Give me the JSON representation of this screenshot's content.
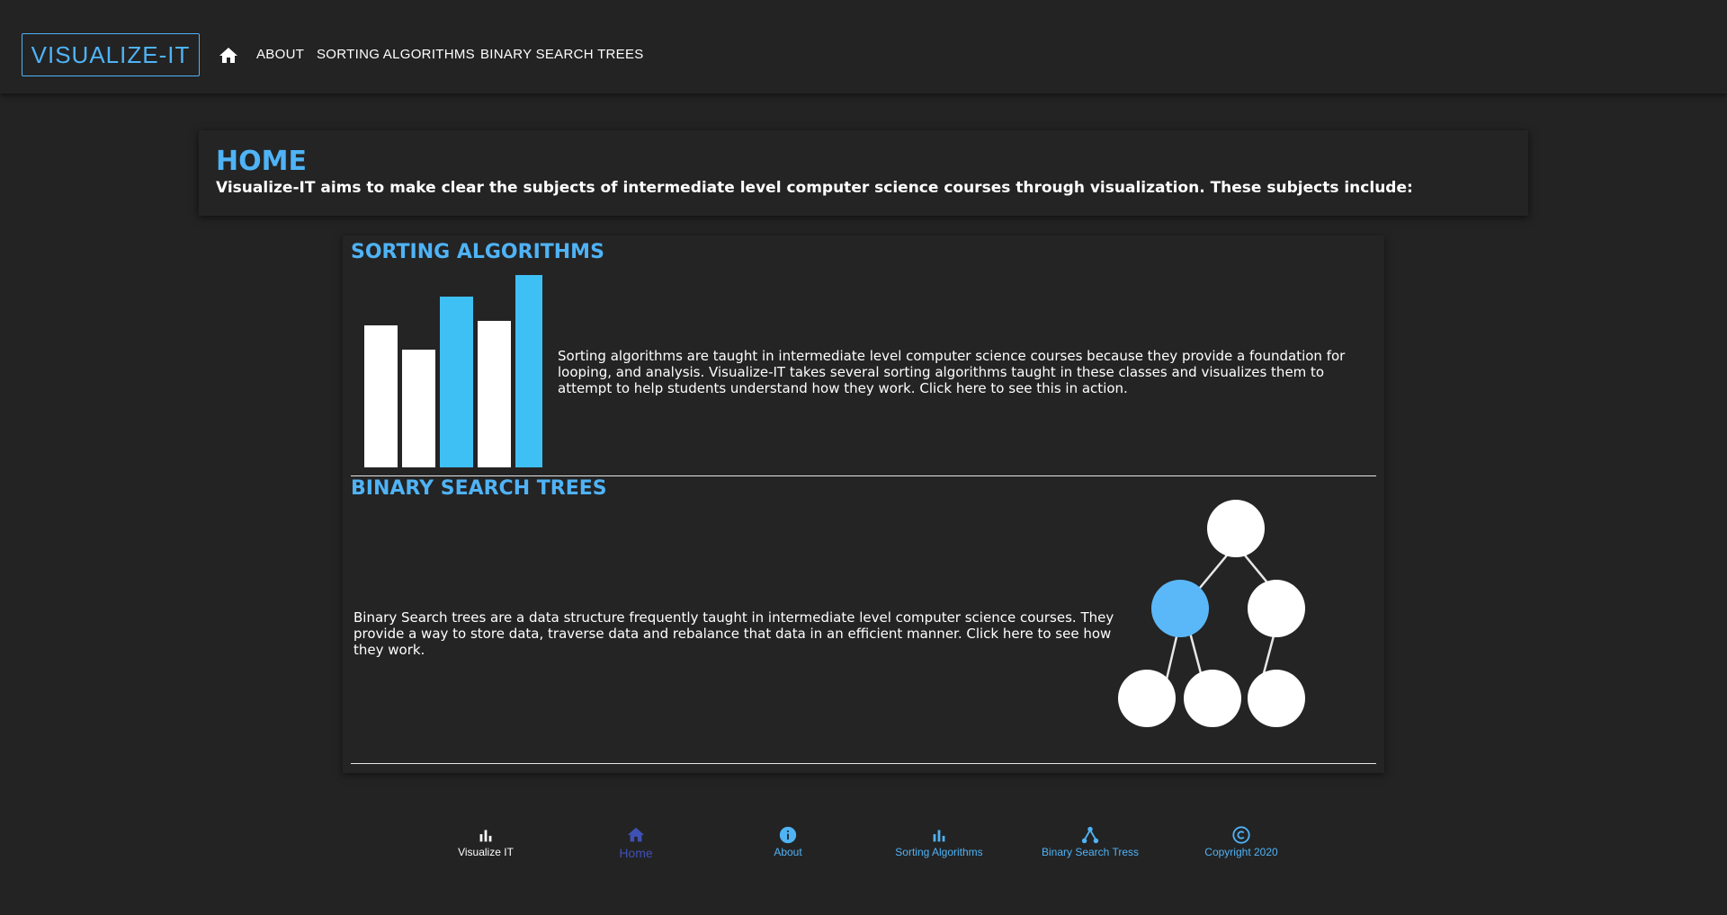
{
  "navbar": {
    "brand": "VISUALIZE-IT",
    "home_icon": "home-icon",
    "links": [
      "ABOUT",
      "SORTING ALGORITHMS",
      "BINARY SEARCH TREES"
    ]
  },
  "home": {
    "title": "HOME",
    "description": "Visualize-IT aims to make clear the subjects of intermediate level computer science courses through visualization. These subjects include:"
  },
  "sections": {
    "sorting": {
      "title": "SORTING ALGORITHMS",
      "text": "Sorting algorithms are taught in intermediate level computer science courses because they provide a foundation for looping, and analysis. Visualize-IT takes several sorting algorithms taught in these classes and visualizes them to attempt to help students understand how they work. Click here to see this in action.",
      "illustration": {
        "bar_heights": [
          0.74,
          0.61,
          0.89,
          0.76,
          1.0
        ],
        "bar_colors": [
          "#ffffff",
          "#ffffff",
          "#3ec0f5",
          "#ffffff",
          "#3ec0f5"
        ]
      }
    },
    "bst": {
      "title": "BINARY SEARCH TREES",
      "text": "Binary Search trees are a data structure frequently taught in intermediate level computer science courses. They provide a way to store data, traverse data and rebalance that data in an efficient manner. Click here to see how they work.",
      "illustration": {
        "highlight_color": "#5bb8f8",
        "node_color": "#ffffff"
      }
    }
  },
  "footer": {
    "items": [
      {
        "label": "Visualize IT",
        "icon": "bar-chart-icon",
        "color": "#ffffff"
      },
      {
        "label": "Home",
        "icon": "home-icon",
        "color": "#3f51b5"
      },
      {
        "label": "About",
        "icon": "info-icon",
        "color": "#4fb3f6"
      },
      {
        "label": "Sorting Algorithms",
        "icon": "bar-chart-icon",
        "color": "#4fb3f6"
      },
      {
        "label": "Binary Search Tress",
        "icon": "tree-icon",
        "color": "#4fb3f6"
      },
      {
        "label": "Copyright 2020",
        "icon": "copyright-icon",
        "color": "#4fb3f6"
      }
    ]
  },
  "colors": {
    "accent": "#4fb3f6",
    "background": "#232323",
    "active": "#3f51b5"
  }
}
